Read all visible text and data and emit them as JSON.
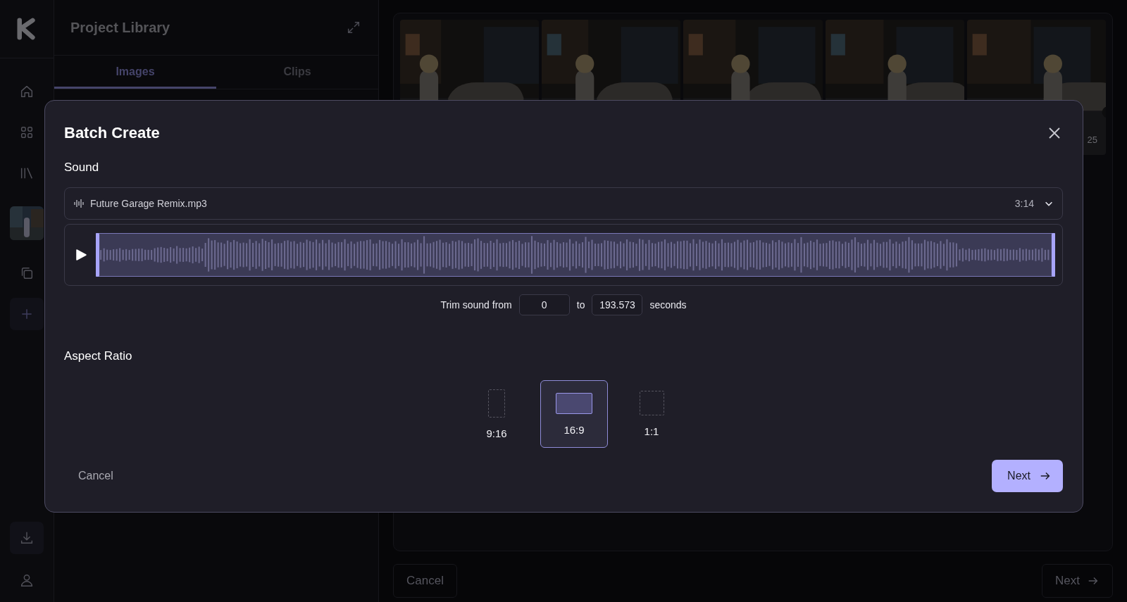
{
  "library": {
    "title": "Project Library",
    "tabs": [
      {
        "label": "Images",
        "selected": true
      },
      {
        "label": "Clips",
        "selected": false
      }
    ]
  },
  "gallery": {
    "badge": "25",
    "footer": {
      "cancel": "Cancel",
      "next": "Next"
    }
  },
  "modal": {
    "title": "Batch Create",
    "sound_label": "Sound",
    "file": {
      "name": "Future Garage Remix.mp3",
      "duration": "3:14"
    },
    "trim": {
      "prefix": "Trim sound from",
      "from": "0",
      "middle": "to",
      "to": "193.573",
      "suffix": "seconds"
    },
    "aspect_label": "Aspect Ratio",
    "ratios": [
      {
        "label": "9:16",
        "kind": "portrait",
        "selected": false
      },
      {
        "label": "16:9",
        "kind": "landscape",
        "selected": true
      },
      {
        "label": "1:1",
        "kind": "square",
        "selected": false
      }
    ],
    "cancel": "Cancel",
    "next": "Next"
  }
}
